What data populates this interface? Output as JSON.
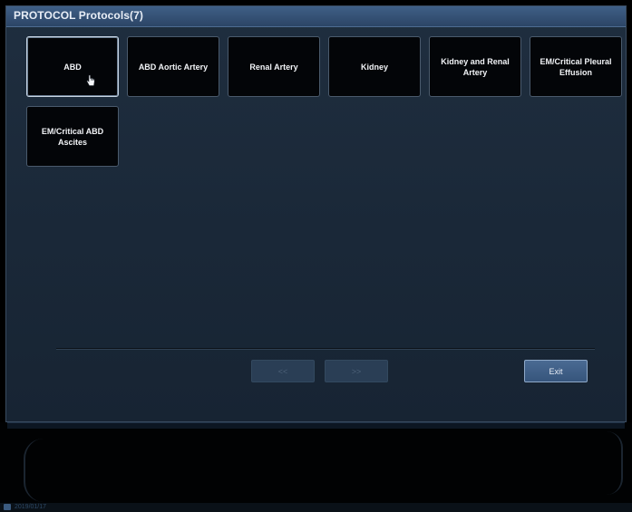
{
  "dialog": {
    "title": "PROTOCOL Protocols(7)"
  },
  "protocols": [
    {
      "label": "ABD",
      "selected": true
    },
    {
      "label": "ABD Aortic Artery",
      "selected": false
    },
    {
      "label": "Renal Artery",
      "selected": false
    },
    {
      "label": "Kidney",
      "selected": false
    },
    {
      "label": "Kidney and Renal Artery",
      "selected": false
    },
    {
      "label": "EM/Critical Pleural Effusion",
      "selected": false
    },
    {
      "label": "EM/Critical ABD Ascites",
      "selected": false
    }
  ],
  "nav": {
    "prev_label": "<<",
    "next_label": ">>",
    "exit_label": "Exit"
  },
  "status": {
    "text": "2019/01/17"
  },
  "colors": {
    "title_bar": "#34507a",
    "button_bg": "#030508",
    "dialog_bg": "#1b2939",
    "exit_button": "#3f5f88"
  }
}
